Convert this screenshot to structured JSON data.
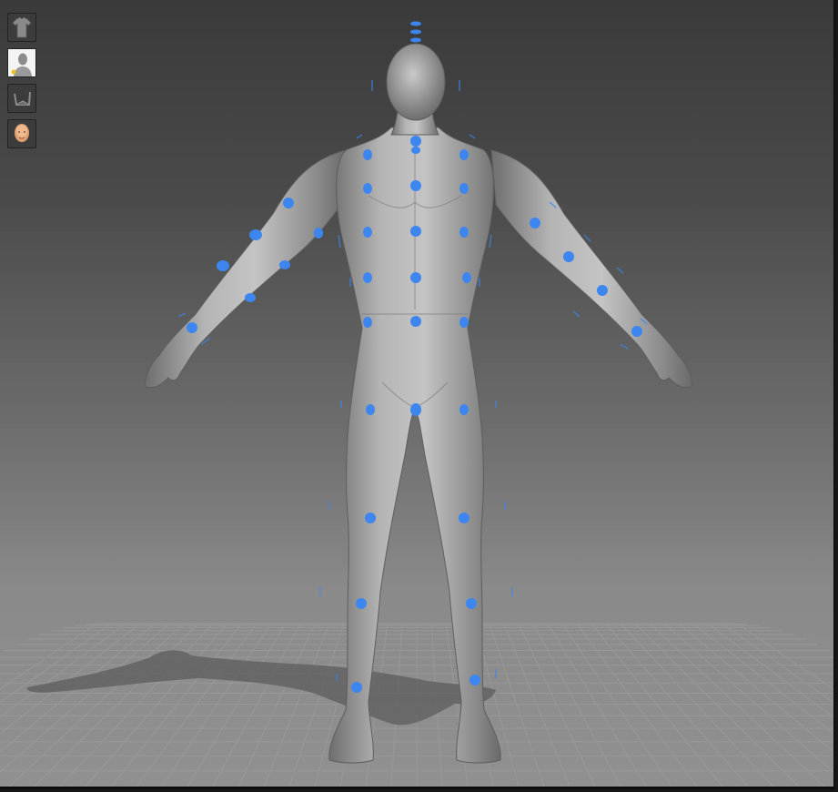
{
  "viewport": {
    "background_top": "#3a3a3a",
    "background_bottom": "#909090",
    "floor_grid_color": "#9c9c9c",
    "model_color": "#a3a3a3",
    "control_point_color": "#3d86f0"
  },
  "toolbar": {
    "buttons": [
      {
        "name": "clothes-button",
        "icon": "tshirt-icon"
      },
      {
        "name": "body-model-button",
        "icon": "bust-icon",
        "active": true
      },
      {
        "name": "environment-button",
        "icon": "floor-box-icon"
      },
      {
        "name": "face-button",
        "icon": "face-icon"
      }
    ]
  }
}
